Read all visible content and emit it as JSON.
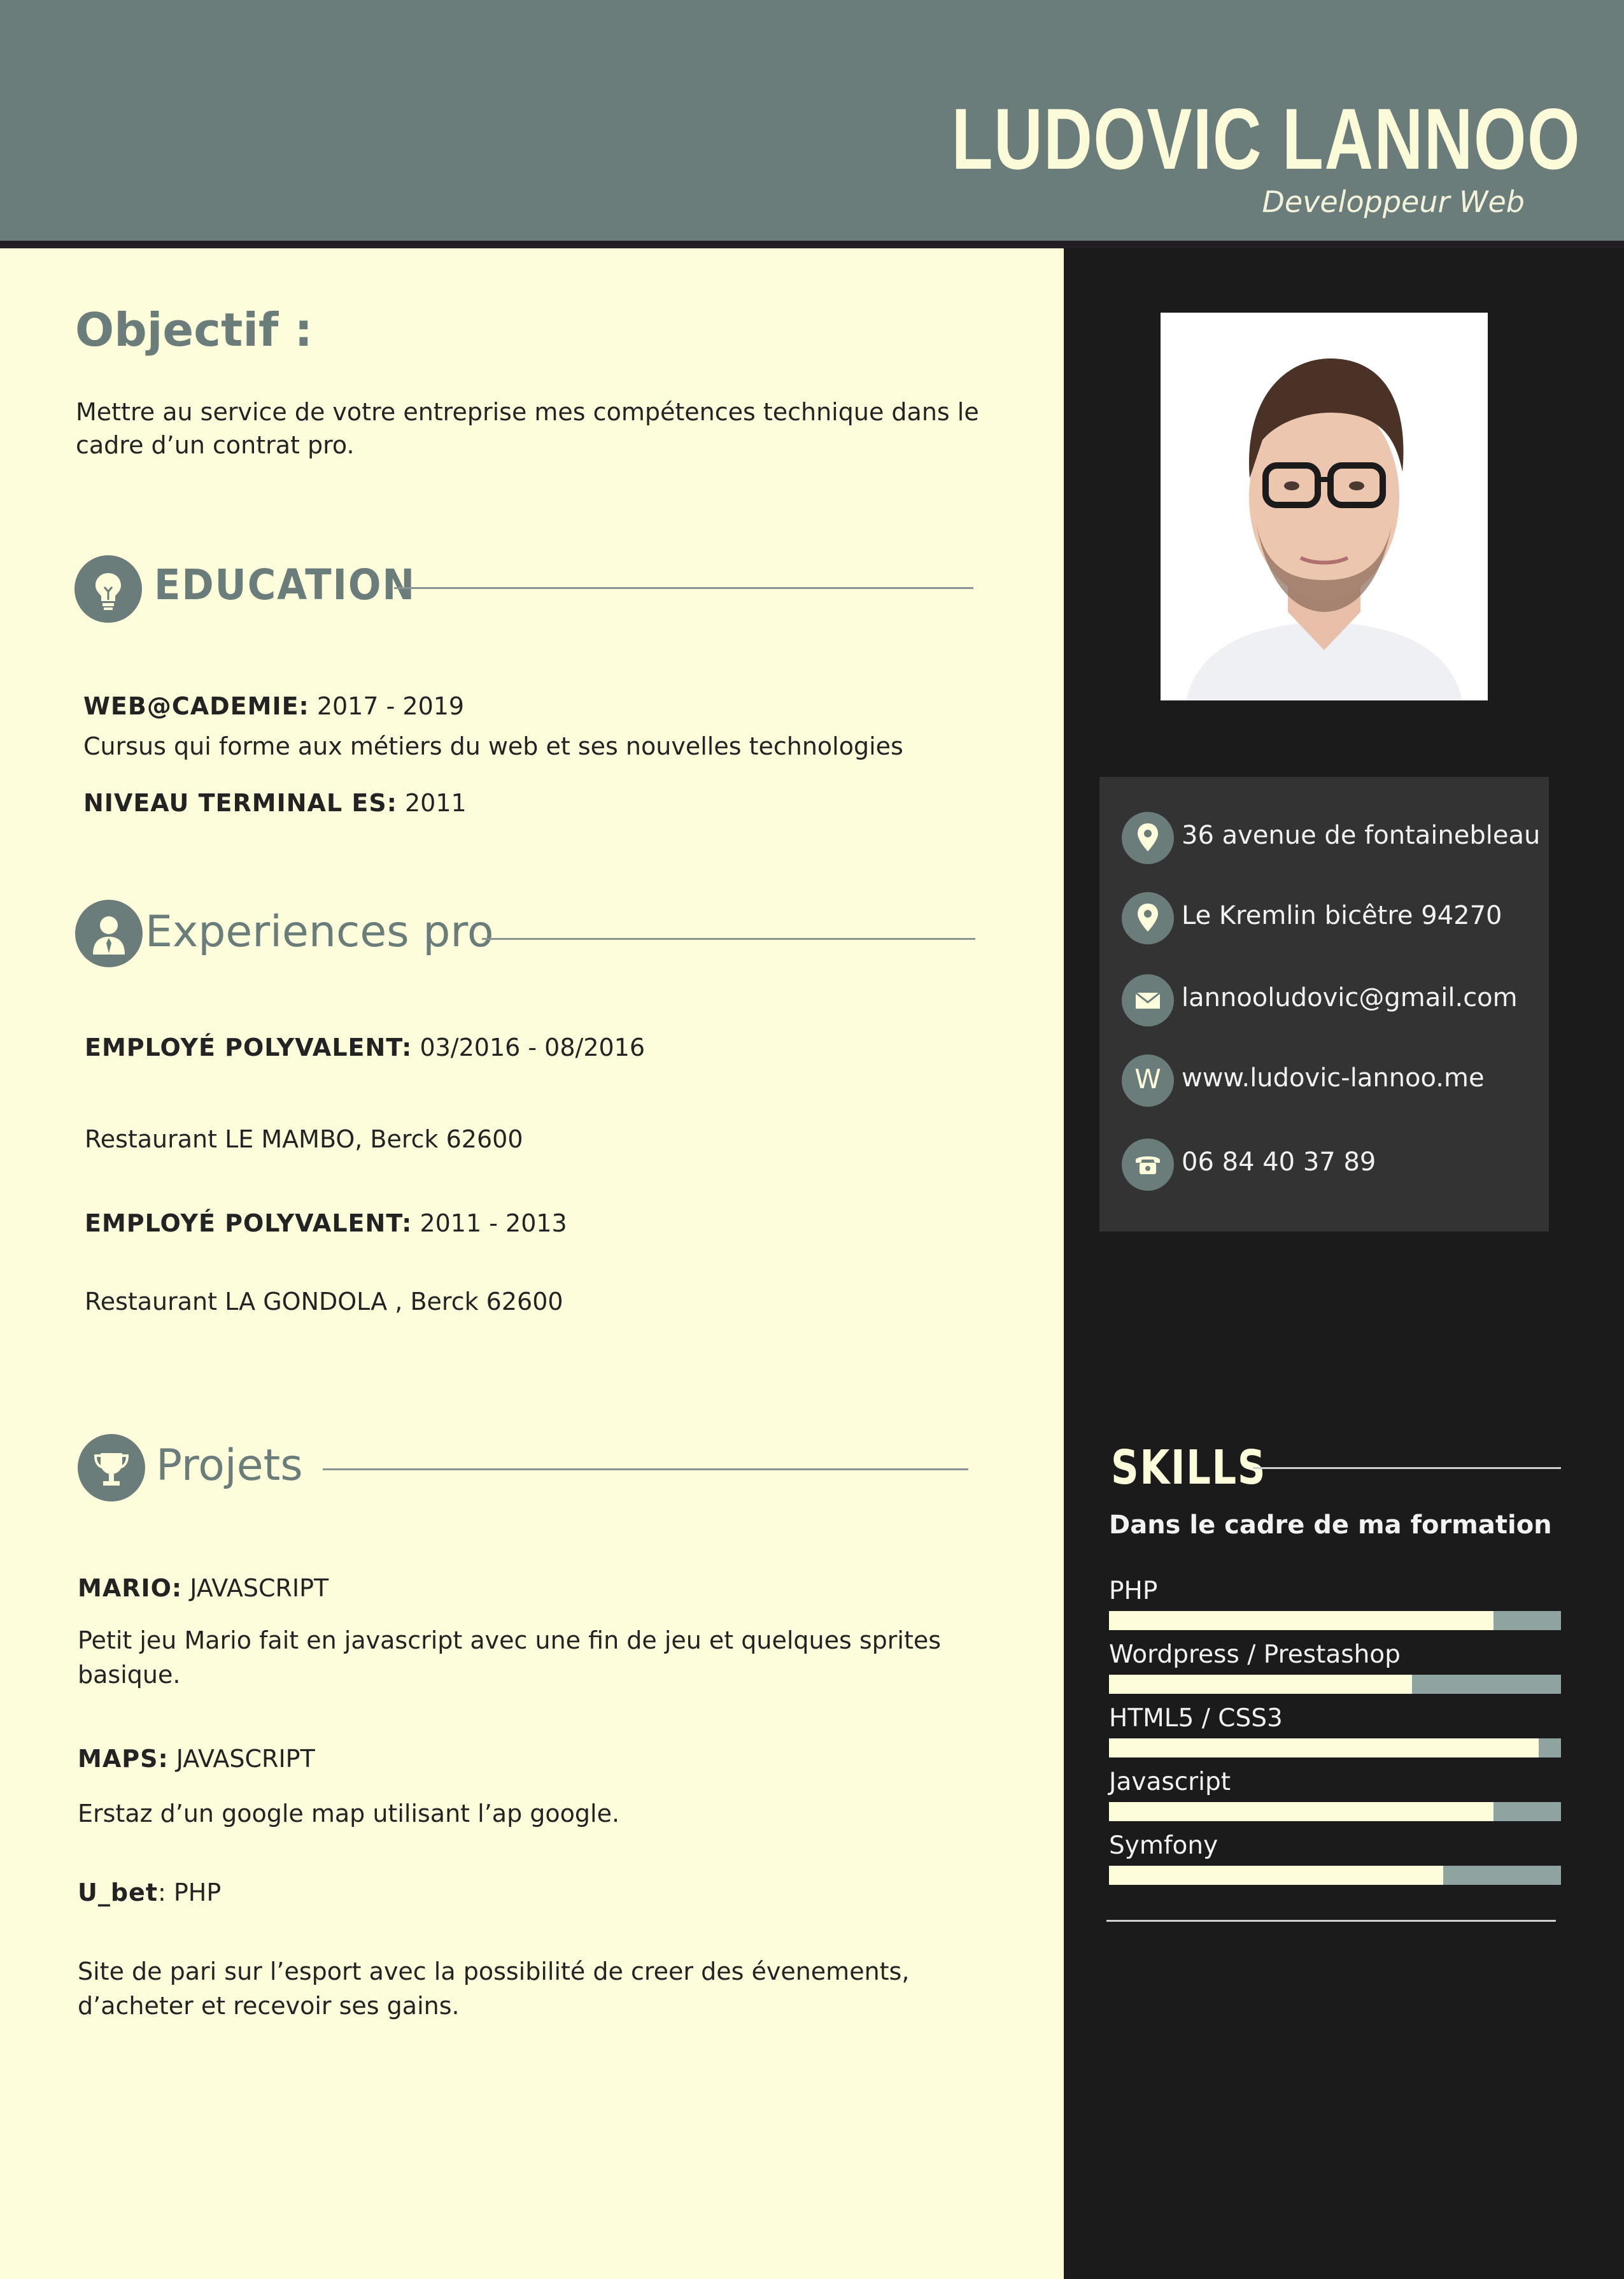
{
  "header": {
    "name": "LUDOVIC LANNOO",
    "job_title": "Developpeur Web"
  },
  "objectif": {
    "title": "Objectif :",
    "text_line1": "Mettre au service de votre entreprise mes compétences technique dans le",
    "text_line2": "cadre d’un contrat pro."
  },
  "education": {
    "title": "EDUCATION",
    "items": [
      {
        "label": "WEB@CADEMIE:",
        "value": " 2017 - 2019",
        "desc": "Cursus qui forme aux métiers du web et ses nouvelles technologies"
      },
      {
        "label": "NIVEAU TERMINAL ES:",
        "value": " 2011"
      }
    ]
  },
  "experiences": {
    "title": "Experiences pro",
    "items": [
      {
        "label": "EMPLOYÉ POLYVALENT:",
        "value": " 03/2016 - 08/2016",
        "place": "Restaurant LE MAMBO, Berck 62600"
      },
      {
        "label": "EMPLOYÉ POLYVALENT:",
        "value": " 2011 - 2013",
        "place": "Restaurant LA GONDOLA , Berck 62600"
      }
    ]
  },
  "projets": {
    "title": "Projets",
    "items": [
      {
        "label": "MARIO:",
        "value": " JAVASCRIPT",
        "desc_line1": "Petit jeu Mario fait en javascript avec une fin de jeu et quelques sprites",
        "desc_line2": "basique."
      },
      {
        "label": "MAPS:",
        "value": " JAVASCRIPT",
        "desc_line1": "Erstaz d’un google map utilisant l’ap google."
      },
      {
        "label": "U_bet",
        "value": ": PHP",
        "desc_line1": "Site de pari sur l’esport avec la possibilité de creer des évenements,",
        "desc_line2": "d’acheter et recevoir ses gains."
      }
    ]
  },
  "contact": [
    {
      "icon": "location-pin-icon",
      "text": "36 avenue de fontainebleau"
    },
    {
      "icon": "location-pin-icon",
      "text": "Le Kremlin bicêtre 94270"
    },
    {
      "icon": "envelope-icon",
      "text": "lannooludovic@gmail.com"
    },
    {
      "icon": "web-icon",
      "glyph": "W",
      "text": "www.ludovic-lannoo.me"
    },
    {
      "icon": "phone-icon",
      "text": " 06 84 40 37 89"
    }
  ],
  "skills": {
    "title": "SKILLS",
    "subtitle": "Dans le cadre de ma formation",
    "items": [
      {
        "name": "PHP",
        "level": 0.85
      },
      {
        "name": "Wordpress / Prestashop",
        "level": 0.67
      },
      {
        "name": "HTML5 / CSS3",
        "level": 0.95
      },
      {
        "name": "Javascript",
        "level": 0.85
      },
      {
        "name": "Symfony",
        "level": 0.74
      }
    ]
  },
  "colors": {
    "header_bg": "#6b7d7b",
    "page_bg": "#fdfddc",
    "sidebar_bg": "#1b1b1b",
    "contact_bg": "#333333",
    "skill_track": "#8fa3a1"
  }
}
